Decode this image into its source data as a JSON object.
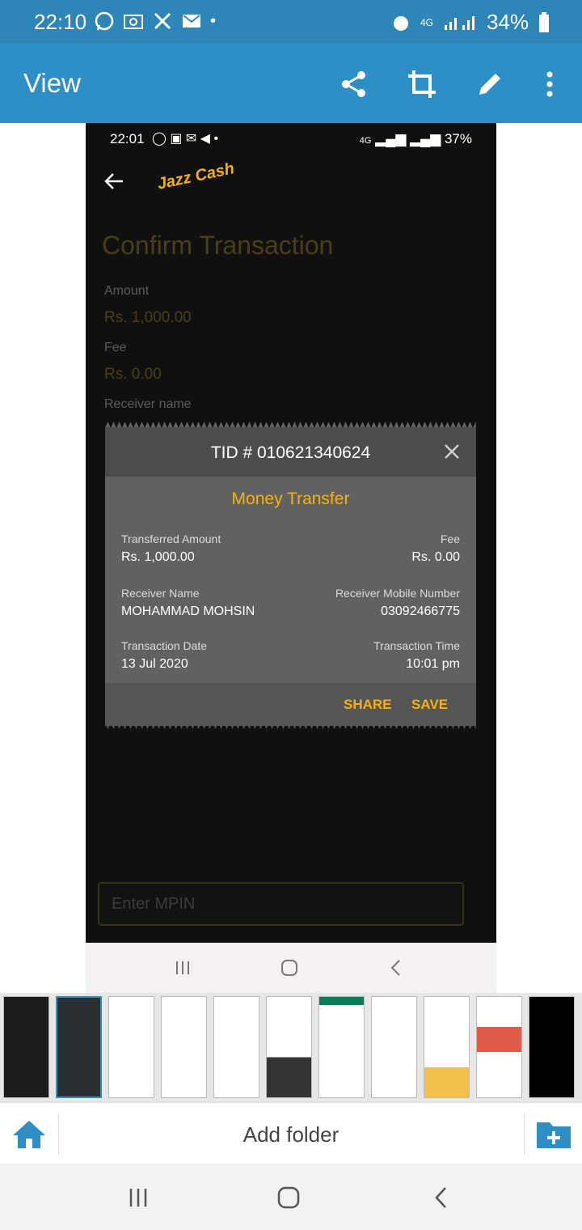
{
  "status_bar": {
    "time": "22:10",
    "battery": "34%",
    "network": "4G"
  },
  "app_bar": {
    "title": "View",
    "share_icon": "share-icon",
    "crop_icon": "crop-icon",
    "edit_icon": "pencil-icon",
    "more_icon": "more-vert-icon"
  },
  "screenshot": {
    "status_time": "22:01",
    "status_battery": "37%",
    "status_network": "4G",
    "logo": "Jazz Cash",
    "page_title": "Confirm Transaction",
    "amount_label": "Amount",
    "amount_value": "Rs. 1,000.00",
    "fee_label": "Fee",
    "fee_value": "Rs. 0.00",
    "receiver_label": "Receiver name",
    "mpin_placeholder": "Enter MPIN",
    "modal": {
      "tid": "TID # 010621340624",
      "subtitle": "Money Transfer",
      "transferred_amount_label": "Transferred Amount",
      "transferred_amount_value": "Rs. 1,000.00",
      "fee_label": "Fee",
      "fee_value": "Rs. 0.00",
      "receiver_name_label": "Receiver Name",
      "receiver_name_value": "MOHAMMAD MOHSIN",
      "receiver_mobile_label": "Receiver Mobile Number",
      "receiver_mobile_value": "03092466775",
      "date_label": "Transaction Date",
      "date_value": "13 Jul 2020",
      "time_label": "Transaction Time",
      "time_value": "10:01 pm",
      "share_label": "SHARE",
      "save_label": "SAVE"
    }
  },
  "bottom_bar": {
    "add_folder": "Add folder"
  },
  "colors": {
    "appbar": "#2e8ec6",
    "accent": "#f6b10e"
  }
}
